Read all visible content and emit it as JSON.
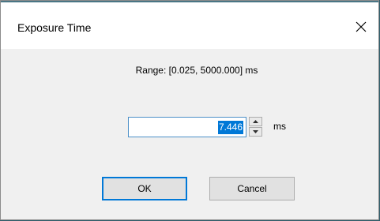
{
  "dialog": {
    "title": "Exposure Time",
    "close_icon": "close-icon"
  },
  "range_text": "Range: [0.025, 5000.000] ms",
  "exposure": {
    "value": "7.446",
    "unit": "ms",
    "up_icon": "spin-up-arrow-icon",
    "down_icon": "spin-down-arrow-icon"
  },
  "buttons": {
    "ok_label": "OK",
    "cancel_label": "Cancel"
  },
  "colors": {
    "selection": "#0078d7",
    "dialog_bg": "#f0f0f0",
    "titlebar_bg": "#ffffff",
    "focus_border": "#0078d7"
  }
}
